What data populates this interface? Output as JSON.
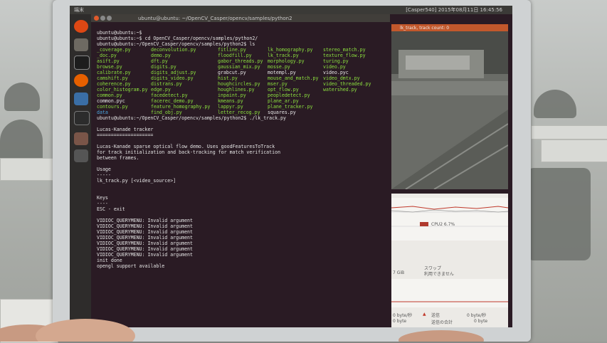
{
  "topbar": {
    "left": "端末",
    "right": "[Casper540] 2015年08月11日 16:45:56"
  },
  "terminal": {
    "title": "ubuntu@ubuntu: ~/OpenCV_Casper/opencv/samples/python2",
    "prompt1": "ubuntu@ubuntu:~$",
    "prompt2": "ubuntu@ubuntu:~$ cd OpenCV_Casper/opencv/samples/python2/",
    "prompt3": "ubuntu@ubuntu:~/OpenCV_Casper/opencv/samples/python2$ ls",
    "files": [
      [
        "_coverage.py",
        "deconvolution.py",
        "fitline.py",
        "lk_homography.py",
        "stereo_match.py"
      ],
      [
        "_doc.py",
        "demo.py",
        "floodfill.py",
        "lk_track.py",
        "texture_flow.py"
      ],
      [
        "asift.py",
        "dft.py",
        "gabor_threads.py",
        "morphology.py",
        "turing.py"
      ],
      [
        "browse.py",
        "digits.py",
        "gaussian_mix.py",
        "mosse.py",
        "video.py"
      ],
      [
        "calibrate.py",
        "digits_adjust.py",
        "grabcut.py",
        "motempl.py",
        "video.pyc"
      ],
      [
        "camshift.py",
        "digits_video.py",
        "hist.py",
        "mouse_and_match.py",
        "video_dmtx.py"
      ],
      [
        "coherence.py",
        "distrans.py",
        "houghcircles.py",
        "mser.py",
        "video_threaded.py"
      ],
      [
        "color_histogram.py",
        "edge.py",
        "houghlines.py",
        "opt_flow.py",
        "watershed.py"
      ],
      [
        "common.py",
        "facedetect.py",
        "inpaint.py",
        "peopledetect.py",
        ""
      ],
      [
        "common.pyc",
        "facerec_demo.py",
        "kmeans.py",
        "plane_ar.py",
        ""
      ],
      [
        "contours.py",
        "feature_homography.py",
        "lappyr.py",
        "plane_tracker.py",
        ""
      ],
      [
        "data",
        "find_obj.py",
        "letter_recog.py",
        "squares.py",
        ""
      ]
    ],
    "prompt4": "ubuntu@ubuntu:~/OpenCV_Casper/opencv/samples/python2$ ./lk_track.py",
    "output": [
      "",
      "Lucas-Kanade tracker",
      "====================",
      "",
      "Lucas-Kanade sparse optical flow demo. Uses goodFeaturesToTrack",
      "for track initialization and back-tracking for match verification",
      "between frames.",
      "",
      "Usage",
      "-----",
      "lk_track.py [<video_source>]",
      "",
      "",
      "Keys",
      "----",
      "ESC - exit",
      "",
      "VIDIOC_QUERYMENU: Invalid argument",
      "VIDIOC_QUERYMENU: Invalid argument",
      "VIDIOC_QUERYMENU: Invalid argument",
      "VIDIOC_QUERYMENU: Invalid argument",
      "VIDIOC_QUERYMENU: Invalid argument",
      "VIDIOC_QUERYMENU: Invalid argument",
      "VIDIOC_QUERYMENU: Invalid argument",
      "init done",
      "opengl support available"
    ]
  },
  "camera": {
    "title": "lk_track, track count: 0"
  },
  "sysmon": {
    "cpu_label": "CPU2 6.7%",
    "mem": "7 GiB",
    "swap_title": "スワップ",
    "swap_value": "利用できません",
    "recv_rate": "0 byte/秒",
    "recv_total": "0 byte",
    "send_label": "送信",
    "send_total_label": "送信の合計",
    "send_rate": "0 byte/秒",
    "send_total": "0 byte"
  },
  "colors": {
    "terminal_bg": "#2a1b24",
    "exec_green": "#8ce03f",
    "dir_blue": "#4aa7e0",
    "titlebar": "#c2582c"
  }
}
